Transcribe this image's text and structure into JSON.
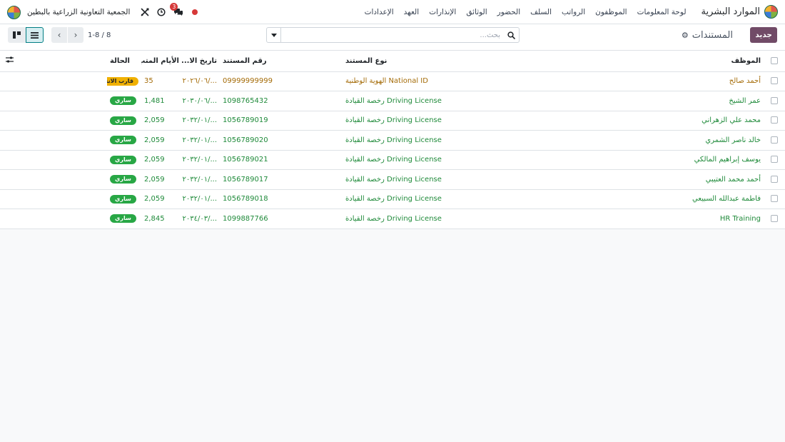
{
  "navbar": {
    "app_title": "الموارد البشرية",
    "menu": [
      "لوحة المعلومات",
      "الموظفون",
      "الرواتب",
      "السلف",
      "الحضور",
      "الوثائق",
      "الإنذارات",
      "العهد",
      "الإعدادات"
    ],
    "company_name": "الجمعية التعاونية الزراعية بالبطين",
    "message_count": "3"
  },
  "control": {
    "new_button": "جديد",
    "breadcrumb": "المستندات",
    "search_placeholder": "بحث...",
    "pager_value": "1-8 / 8"
  },
  "table": {
    "headers": {
      "employee": "الموظف",
      "doc_type": "نوع المستند",
      "doc_number": "رقم المستند",
      "expiry_date": "تاريخ الا...",
      "remaining_days": "الأيام المتب...",
      "status": "الحالة"
    },
    "rows": [
      {
        "employee": "أحمد صالح",
        "doc_type": "National ID الهوية الوطنية",
        "doc_number": "09999999999",
        "expiry_date": "٢٠٢٦/٠٦/...",
        "remaining_days": "35",
        "status": "قارب الانتهاء",
        "tone": "amber"
      },
      {
        "employee": "عمر الشيخ",
        "doc_type": "Driving License رخصة القيادة",
        "doc_number": "1098765432",
        "expiry_date": "٢٠٣٠/٠٦/...",
        "remaining_days": "1,481",
        "status": "ساري",
        "tone": "green"
      },
      {
        "employee": "محمد علي الزهراني",
        "doc_type": "Driving License رخصة القيادة",
        "doc_number": "1056789019",
        "expiry_date": "٢٠٣٢/٠١/...",
        "remaining_days": "2,059",
        "status": "ساري",
        "tone": "green"
      },
      {
        "employee": "خالد ناصر الشمري",
        "doc_type": "Driving License رخصة القيادة",
        "doc_number": "1056789020",
        "expiry_date": "٢٠٣٢/٠١/...",
        "remaining_days": "2,059",
        "status": "ساري",
        "tone": "green"
      },
      {
        "employee": "يوسف إبراهيم المالكي",
        "doc_type": "Driving License رخصة القيادة",
        "doc_number": "1056789021",
        "expiry_date": "٢٠٣٢/٠١/...",
        "remaining_days": "2,059",
        "status": "ساري",
        "tone": "green"
      },
      {
        "employee": "أحمد محمد العتيبي",
        "doc_type": "Driving License رخصة القيادة",
        "doc_number": "1056789017",
        "expiry_date": "٢٠٣٢/٠١/...",
        "remaining_days": "2,059",
        "status": "ساري",
        "tone": "green"
      },
      {
        "employee": "فاطمة عبدالله السبيعي",
        "doc_type": "Driving License رخصة القيادة",
        "doc_number": "1056789018",
        "expiry_date": "٢٠٣٢/٠١/...",
        "remaining_days": "2,059",
        "status": "ساري",
        "tone": "green"
      },
      {
        "employee": "HR Training",
        "doc_type": "Driving License رخصة القيادة",
        "doc_number": "1099887766",
        "expiry_date": "٢٠٣٤/٠٣/...",
        "remaining_days": "2,845",
        "status": "ساري",
        "tone": "green"
      }
    ]
  },
  "colors": {
    "brand": "#714b67",
    "accent": "#017e84",
    "status_ok": "#28a745",
    "status_warn": "#f0b000",
    "text_green": "#1f8a3a",
    "text_amber": "#a46b07"
  },
  "icons": [
    "app-logo-icon",
    "company-logo-icon",
    "tools-icon",
    "clock-icon",
    "chat-icon",
    "gear-icon",
    "search-icon",
    "caret-down-icon",
    "chevron-left-icon",
    "chevron-right-icon",
    "list-view-icon",
    "kanban-view-icon",
    "column-options-icon"
  ]
}
